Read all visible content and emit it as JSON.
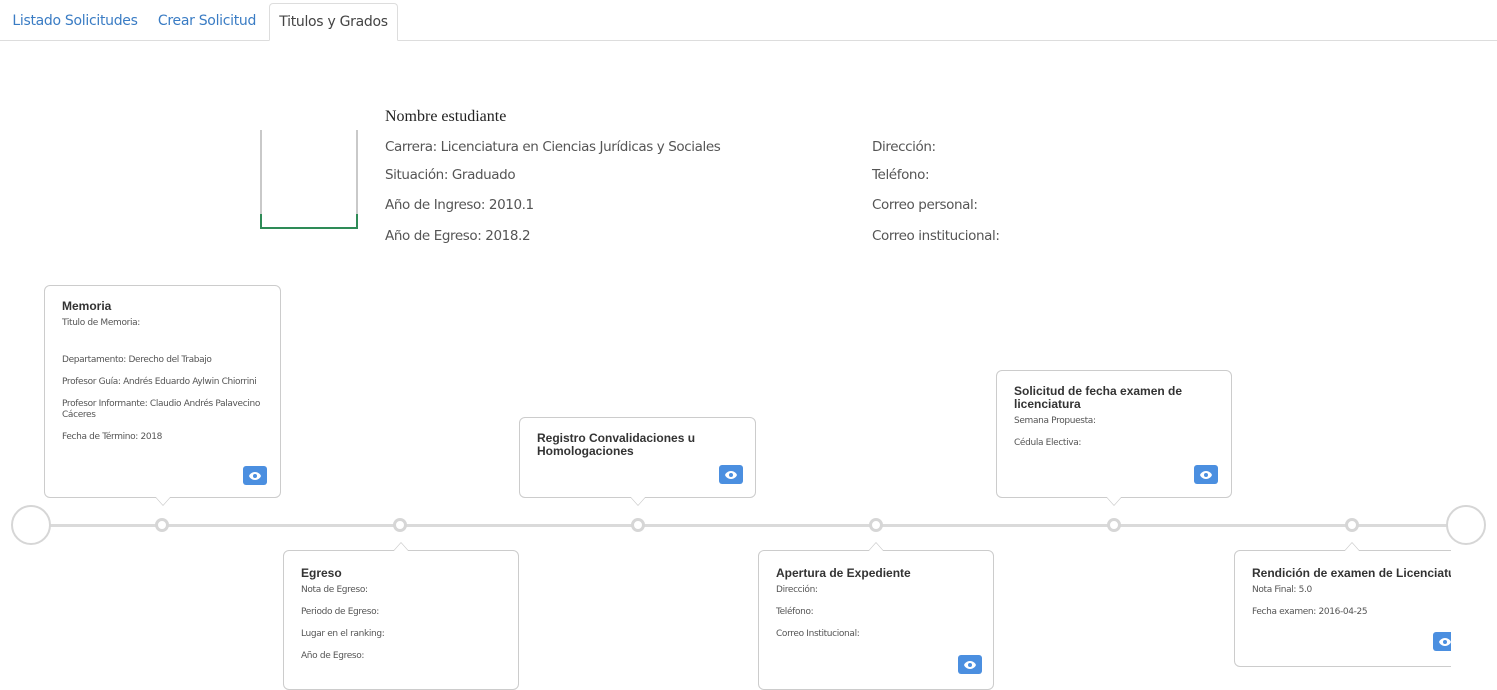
{
  "tabs": [
    {
      "label": "Listado Solicitudes"
    },
    {
      "label": "Crear Solicitud"
    },
    {
      "label": "Titulos y Grados"
    }
  ],
  "student": {
    "name": "Nombre estudiante",
    "carrera": "Carrera: Licenciatura en Ciencias Jurídicas y Sociales",
    "situacion": "Situación: Graduado",
    "ingreso": "Año de Ingreso: 2010.1",
    "egreso": "Año de Egreso: 2018.2",
    "direccion": "Dirección:",
    "telefono": "Teléfono:",
    "correo_personal": "Correo personal:",
    "correo_institucional": "Correo institucional:"
  },
  "timeline": {
    "memoria": {
      "title": "Memoria",
      "titulo": "Titulo de Memoria:",
      "departamento": "Departamento: Derecho del Trabajo",
      "profesor_guia": "Profesor Guía: Andrés Eduardo Aylwin Chiorrini",
      "profesor_informante": "Profesor Informante: Claudio Andrés Palavecino Cáceres",
      "fecha_termino": "Fecha de Término: 2018"
    },
    "egreso": {
      "title": "Egreso",
      "nota": "Nota de Egreso:",
      "periodo": "Periodo de Egreso:",
      "ranking": "Lugar en el ranking:",
      "anio": "Año de Egreso:"
    },
    "convalidaciones": {
      "title": "Registro Convalidaciones u Homologaciones"
    },
    "expediente": {
      "title": "Apertura de Expediente",
      "direccion": "Dirección:",
      "telefono": "Teléfono:",
      "correo": "Correo Institucional:"
    },
    "solicitud_fecha": {
      "title": "Solicitud de fecha examen de licenciatura",
      "semana": "Semana Propuesta:",
      "cedula": "Cédula Electiva:"
    },
    "rendicion": {
      "title": "Rendición de examen de Licenciatu",
      "nota": "Nota Final: 5.0",
      "fecha": "Fecha examen: 2016-04-25"
    }
  },
  "icons": {
    "view": "eye-icon"
  },
  "colors": {
    "tab_link": "#3a7cc4",
    "button": "#4b8fe0",
    "timeline": "#dadada",
    "photo_accent": "#2e8b57"
  }
}
